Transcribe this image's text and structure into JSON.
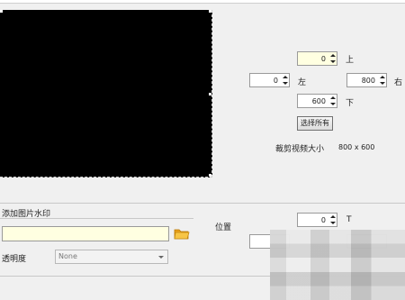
{
  "crop": {
    "top_value": "0",
    "top_label": "上",
    "left_value": "0",
    "left_label": "左",
    "right_value": "800",
    "right_label": "右",
    "bottom_value": "600",
    "bottom_label": "下",
    "select_all_label": "选择所有",
    "size_label": "裁剪视频大小",
    "size_value": "800 x 600"
  },
  "watermark": {
    "section_title": "添加图片水印",
    "image_path": "",
    "transparency_label": "透明度",
    "transparency_value": "None",
    "position_label": "位置",
    "position_top_value": "0",
    "position_top_label": "T"
  }
}
